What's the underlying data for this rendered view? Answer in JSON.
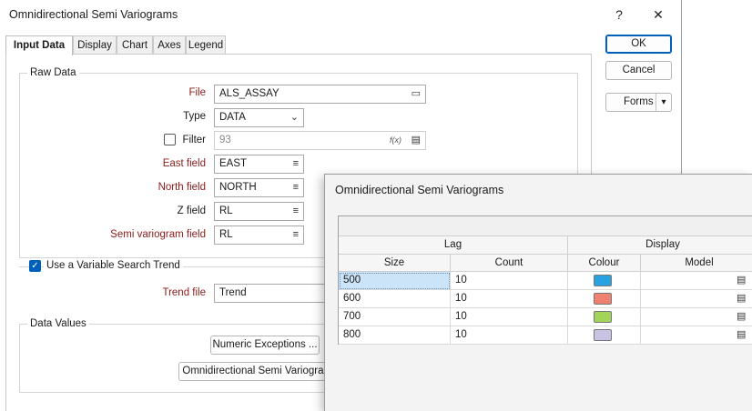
{
  "window": {
    "title": "Omnidirectional Semi Variograms",
    "help": "?",
    "close": "✕"
  },
  "tabs": [
    {
      "label": "Input Data"
    },
    {
      "label": "Display"
    },
    {
      "label": "Chart"
    },
    {
      "label": "Axes"
    },
    {
      "label": "Legend"
    }
  ],
  "buttons": {
    "ok": "OK",
    "cancel": "Cancel",
    "forms": "Forms",
    "forms_arrow": "▾"
  },
  "raw_data": {
    "group_label": "Raw Data",
    "file_label": "File",
    "file_value": "ALS_ASSAY",
    "type_label": "Type",
    "type_value": "DATA",
    "filter_label": "Filter",
    "filter_value": "93",
    "filter_fx": "f(x)",
    "east_label": "East field",
    "east_value": "EAST",
    "north_label": "North field",
    "north_value": "NORTH",
    "z_label": "Z field",
    "z_value": "RL",
    "sv_label": "Semi variogram field",
    "sv_value": "RL"
  },
  "trend": {
    "checkbox_label": "Use a Variable Search Trend",
    "checked": true,
    "trend_file_label": "Trend file",
    "trend_file_value": "Trend"
  },
  "data_values": {
    "group_label": "Data Values",
    "numeric_exceptions": "Numeric Exceptions ...",
    "omni_button": "Omnidirectional Semi Variograms ..."
  },
  "subdialog": {
    "title": "Omnidirectional Semi Variograms",
    "group_headers": [
      "Lag",
      "Display"
    ],
    "columns": [
      "Size",
      "Count",
      "Colour",
      "Model"
    ],
    "rows": [
      {
        "size": "500",
        "count": "10",
        "colour": "#29a3e0"
      },
      {
        "size": "600",
        "count": "10",
        "colour": "#f08070"
      },
      {
        "size": "700",
        "count": "10",
        "colour": "#a3d45a"
      },
      {
        "size": "800",
        "count": "10",
        "colour": "#c8c3e3"
      }
    ]
  }
}
